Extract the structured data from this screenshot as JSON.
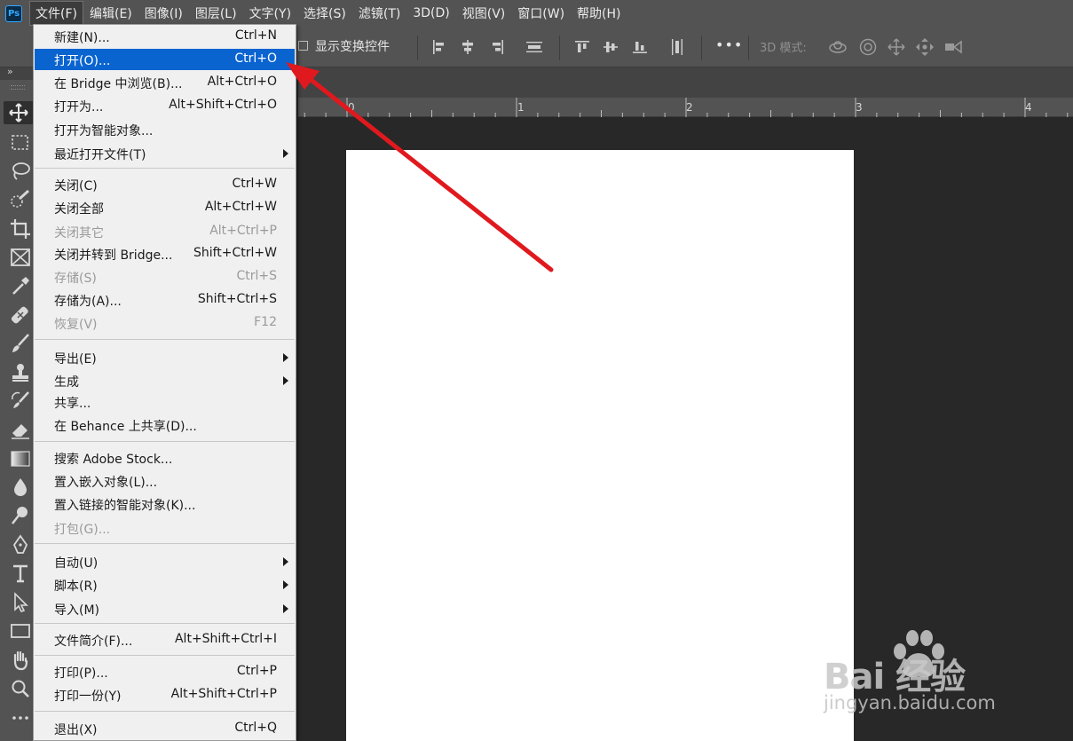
{
  "app": {
    "logo": "Ps"
  },
  "menubar": {
    "items": [
      "文件(F)",
      "编辑(E)",
      "图像(I)",
      "图层(L)",
      "文字(Y)",
      "选择(S)",
      "滤镜(T)",
      "3D(D)",
      "视图(V)",
      "窗口(W)",
      "帮助(H)"
    ]
  },
  "options": {
    "show_transform_label": "显示变换控件",
    "more_label": "•••",
    "mode_3d_label": "3D 模式:",
    "align_icons": [
      "align-left-edges-icon",
      "align-horizontal-centers-icon",
      "align-right-edges-icon",
      "distribute-horizontal-icon",
      "align-top-edges-icon",
      "align-vertical-centers-icon",
      "align-bottom-edges-icon",
      "distribute-vertical-icon"
    ],
    "mode_3d_icons": [
      "orbit-3d-icon",
      "roll-3d-icon",
      "drag-3d-icon",
      "slide-3d-icon",
      "scale-3d-icon"
    ]
  },
  "ruler": {
    "labels": [
      "0",
      "1",
      "2",
      "3",
      "4"
    ]
  },
  "tools": [
    "move-tool-icon",
    "marquee-tool-icon",
    "lasso-tool-icon",
    "quick-selection-tool-icon",
    "crop-tool-icon",
    "frame-tool-icon",
    "eyedropper-tool-icon",
    "healing-brush-tool-icon",
    "brush-tool-icon",
    "clone-stamp-tool-icon",
    "history-brush-tool-icon",
    "eraser-tool-icon",
    "gradient-tool-icon",
    "blur-tool-icon",
    "dodge-tool-icon",
    "pen-tool-icon",
    "type-tool-icon",
    "path-selection-tool-icon",
    "rectangle-tool-icon",
    "hand-tool-icon",
    "zoom-tool-icon",
    "more-tools-icon"
  ],
  "file_menu": {
    "items": [
      {
        "label": "新建(N)...",
        "shortcut": "Ctrl+N"
      },
      {
        "label": "打开(O)...",
        "shortcut": "Ctrl+O",
        "highlighted": true
      },
      {
        "label": "在 Bridge 中浏览(B)...",
        "shortcut": "Alt+Ctrl+O"
      },
      {
        "label": "打开为...",
        "shortcut": "Alt+Shift+Ctrl+O"
      },
      {
        "label": "打开为智能对象...",
        "shortcut": ""
      },
      {
        "label": "最近打开文件(T)",
        "shortcut": "",
        "submenu": true
      },
      {
        "label": "关闭(C)",
        "shortcut": "Ctrl+W"
      },
      {
        "label": "关闭全部",
        "shortcut": "Alt+Ctrl+W"
      },
      {
        "label": "关闭其它",
        "shortcut": "Alt+Ctrl+P",
        "disabled": true
      },
      {
        "label": "关闭并转到 Bridge...",
        "shortcut": "Shift+Ctrl+W"
      },
      {
        "label": "存储(S)",
        "shortcut": "Ctrl+S",
        "disabled": true
      },
      {
        "label": "存储为(A)...",
        "shortcut": "Shift+Ctrl+S"
      },
      {
        "label": "恢复(V)",
        "shortcut": "F12",
        "disabled": true
      },
      {
        "label": "导出(E)",
        "shortcut": "",
        "submenu": true
      },
      {
        "label": "生成",
        "shortcut": "",
        "submenu": true
      },
      {
        "label": "共享...",
        "shortcut": ""
      },
      {
        "label": "在 Behance 上共享(D)...",
        "shortcut": ""
      },
      {
        "label": "搜索 Adobe Stock...",
        "shortcut": ""
      },
      {
        "label": "置入嵌入对象(L)...",
        "shortcut": ""
      },
      {
        "label": "置入链接的智能对象(K)...",
        "shortcut": ""
      },
      {
        "label": "打包(G)...",
        "shortcut": "",
        "disabled": true
      },
      {
        "label": "自动(U)",
        "shortcut": "",
        "submenu": true
      },
      {
        "label": "脚本(R)",
        "shortcut": "",
        "submenu": true
      },
      {
        "label": "导入(M)",
        "shortcut": "",
        "submenu": true
      },
      {
        "label": "文件简介(F)...",
        "shortcut": "Alt+Shift+Ctrl+I"
      },
      {
        "label": "打印(P)...",
        "shortcut": "Ctrl+P"
      },
      {
        "label": "打印一份(Y)",
        "shortcut": "Alt+Shift+Ctrl+P"
      },
      {
        "label": "退出(X)",
        "shortcut": "Ctrl+Q"
      }
    ]
  },
  "annotation": {
    "color": "#e0191e"
  },
  "watermark": {
    "brand": "Bai 经验",
    "url": "jingyan.baidu.com"
  },
  "colors": {
    "highlight": "#0a64d0",
    "ps_blue": "#31a8ff"
  }
}
